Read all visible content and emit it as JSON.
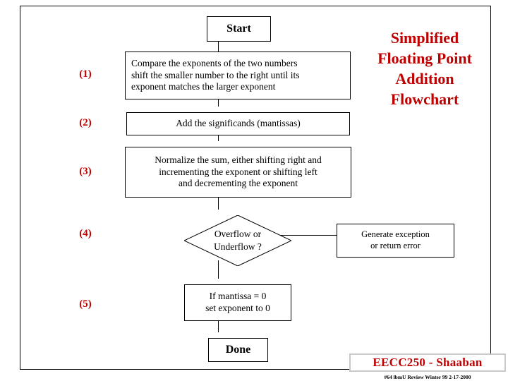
{
  "title": {
    "lines": [
      "Simplified",
      "Floating Point",
      "Addition",
      "Flowchart"
    ],
    "color": "#c00000"
  },
  "steps": [
    {
      "label": "(1)"
    },
    {
      "label": "(2)"
    },
    {
      "label": "(3)"
    },
    {
      "label": "(4)"
    },
    {
      "label": "(5)"
    }
  ],
  "flow": {
    "start": "Start",
    "compare": {
      "line1": "Compare the exponents of the two numbers",
      "line2": "shift the smaller number to the right until its",
      "line3": "exponent matches the larger exponent"
    },
    "add": "Add the significands (mantissas)",
    "normalize": {
      "line1": "Normalize the sum, either shifting right and",
      "line2": "incrementing the exponent or shifting left",
      "line3": "and decrementing the exponent"
    },
    "decision": {
      "line1": "Overflow or",
      "line2": "Underflow ?"
    },
    "exception": {
      "line1": "Generate exception",
      "line2": "or return error"
    },
    "mantissa": {
      "line1": "If mantissa = 0",
      "line2": "set exponent to 0"
    },
    "done": "Done"
  },
  "footer": {
    "banner": "EECC250 - Shaaban",
    "note": "#64  lbmU Review  Winter 99  2-17-2000",
    "color": "#c00000"
  }
}
